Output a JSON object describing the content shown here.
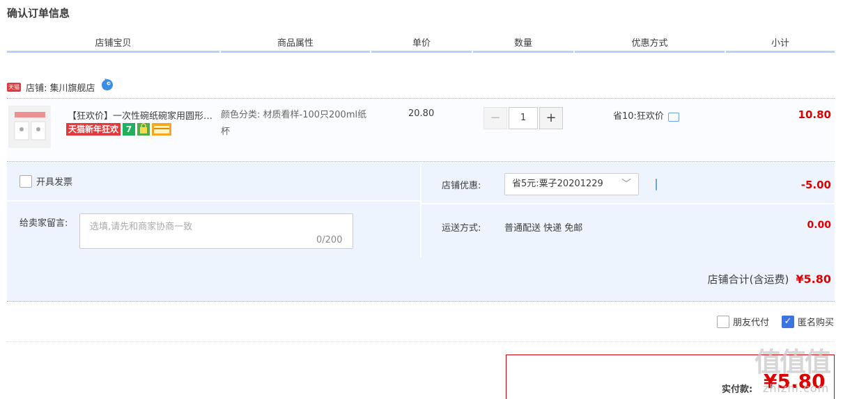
{
  "page": {
    "title": "确认订单信息"
  },
  "table_header": [
    "店铺宝贝",
    "商品属性",
    "单价",
    "数量",
    "优惠方式",
    "小计"
  ],
  "shop": {
    "platform_tag": "天猫",
    "label": "店铺: 集川旗舰店"
  },
  "item": {
    "title": "【狂欢价】一次性碗纸碗家用圆形纸杯",
    "badge_text": "天猫新年狂欢",
    "attributes": "颜色分类: 材质看样-100只200ml纸杯",
    "unit_price": "20.80",
    "quantity": "1",
    "promotion": "省10:狂欢价",
    "subtotal": "10.80"
  },
  "options": {
    "invoice_label": "开具发票",
    "message_label": "给卖家留言:",
    "message_placeholder": "选填,请先和商家协商一致",
    "message_count": "0/200",
    "shop_discount_label": "店铺优惠:",
    "shop_discount_selected": "省5元:粟子20201229",
    "shop_discount_value": "-5.00",
    "shipping_label": "运送方式:",
    "shipping_value": "普通配送 快递 免邮",
    "shipping_cost": "0.00"
  },
  "totals": {
    "shop_total_label": "店铺合计(含运费)",
    "shop_total_value": "¥5.80",
    "friend_pay_label": "朋友代付",
    "anonymous_label": "匿名购买",
    "actual_pay_label": "实付款:",
    "actual_pay_value": "¥5.80"
  },
  "watermark": {
    "main": "值值值",
    "sub": "zhizhi.com"
  },
  "colors": {
    "accent_red": "#dd0000",
    "header_line": "#b2d1ff",
    "panel_bg": "#eef4fe",
    "check_blue": "#3b74e0"
  },
  "icons": [
    "aliwangwang-icon",
    "chat-icon",
    "chevron-down-icon",
    "minus-icon",
    "plus-icon",
    "checkmark-icon"
  ]
}
